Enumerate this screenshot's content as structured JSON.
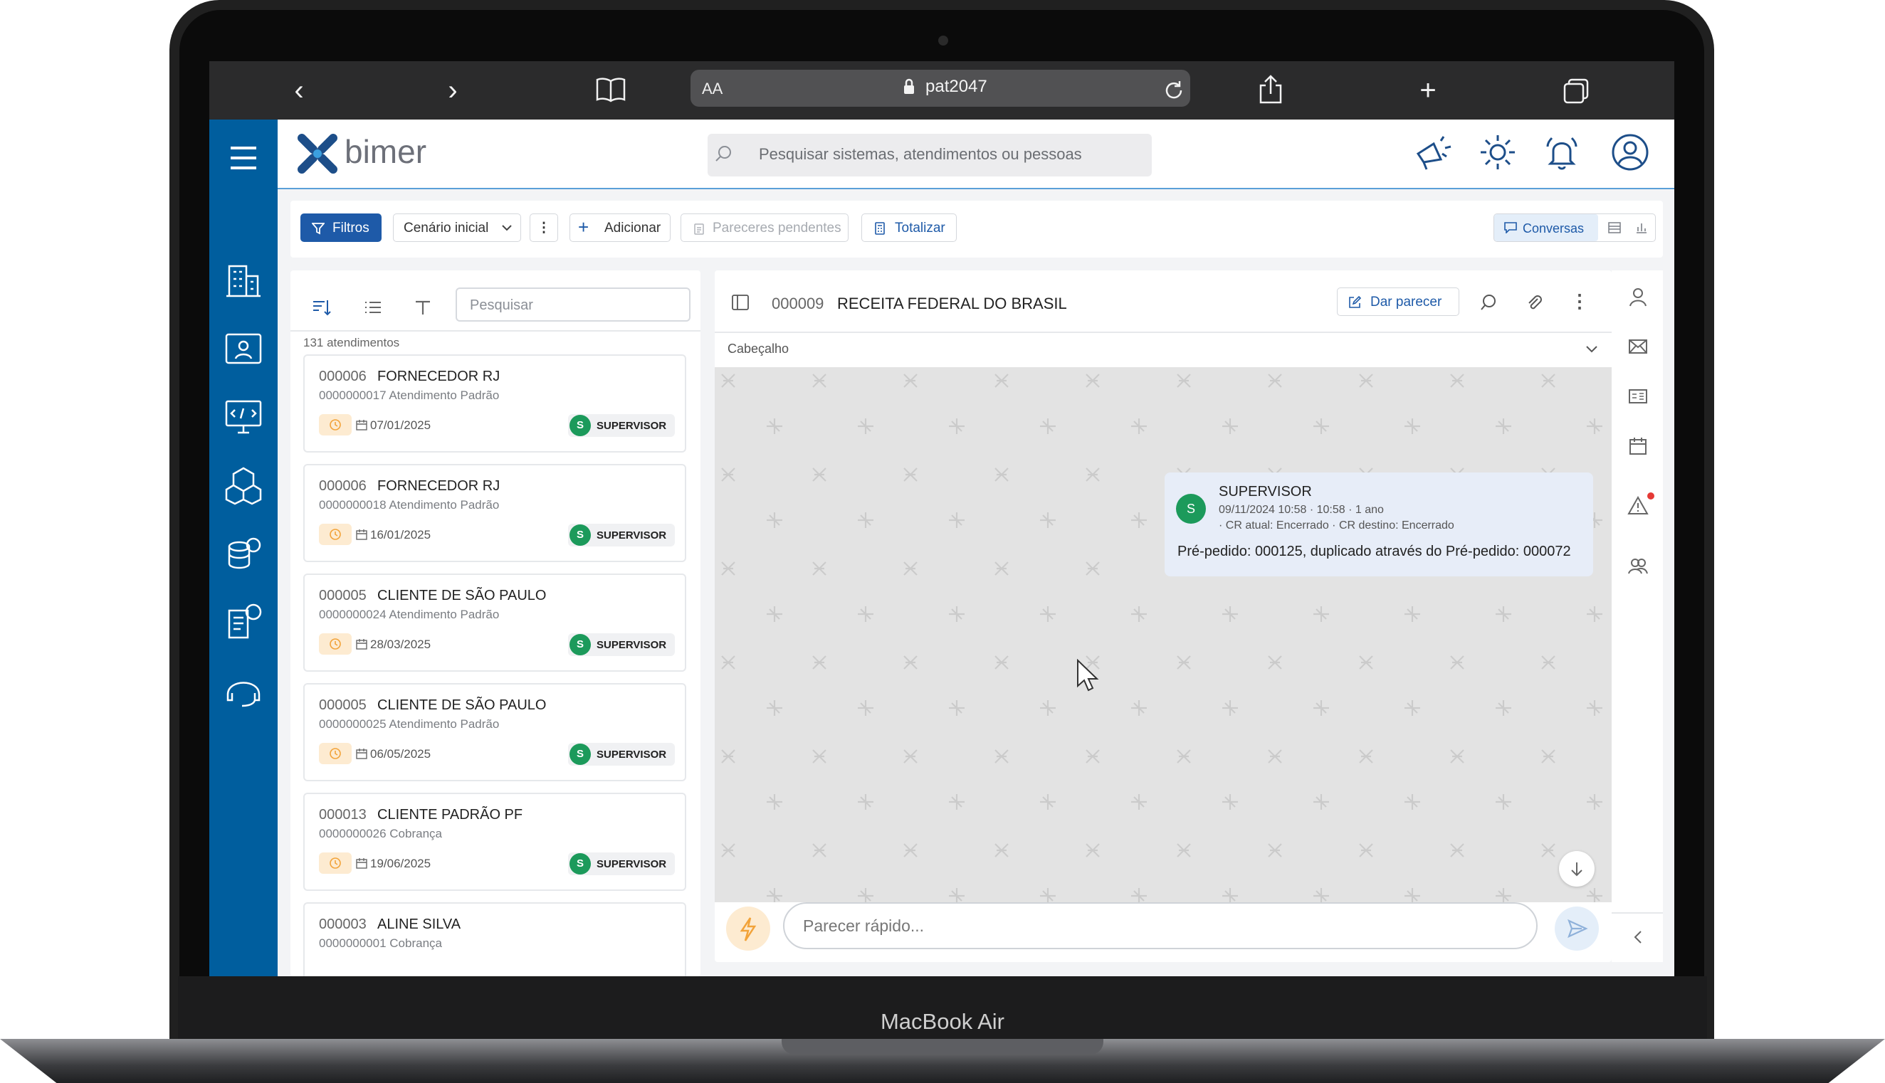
{
  "device": {
    "label": "MacBook Air"
  },
  "browser": {
    "text_size_label": "AA",
    "url": "pat2047"
  },
  "app": {
    "brand": "bimer",
    "search_placeholder": "Pesquisar sistemas, atendimentos ou pessoas"
  },
  "toolbar": {
    "filters_label": "Filtros",
    "scenario_label": "Cenário inicial",
    "add_label": "Adicionar",
    "pending_label": "Pareceres pendentes",
    "totalize_label": "Totalizar",
    "conversations_label": "Conversas"
  },
  "list": {
    "search_placeholder": "Pesquisar",
    "count_label": "131 atendimentos",
    "items": [
      {
        "code": "000006",
        "name": "FORNECEDOR RJ",
        "sub": "0000000017 Atendimento Padrão",
        "date": "07/01/2025",
        "user_initial": "S",
        "user": "SUPERVISOR"
      },
      {
        "code": "000006",
        "name": "FORNECEDOR RJ",
        "sub": "0000000018 Atendimento Padrão",
        "date": "16/01/2025",
        "user_initial": "S",
        "user": "SUPERVISOR"
      },
      {
        "code": "000005",
        "name": "CLIENTE DE SÃO PAULO",
        "sub": "0000000024 Atendimento Padrão",
        "date": "28/03/2025",
        "user_initial": "S",
        "user": "SUPERVISOR"
      },
      {
        "code": "000005",
        "name": "CLIENTE DE SÃO PAULO",
        "sub": "0000000025 Atendimento Padrão",
        "date": "06/05/2025",
        "user_initial": "S",
        "user": "SUPERVISOR"
      },
      {
        "code": "000013",
        "name": "CLIENTE PADRÃO PF",
        "sub": "0000000026 Cobrança",
        "date": "19/06/2025",
        "user_initial": "S",
        "user": "SUPERVISOR"
      },
      {
        "code": "000003",
        "name": "ALINE SILVA",
        "sub": "0000000001 Cobrança",
        "date": "",
        "user_initial": "",
        "user": ""
      }
    ]
  },
  "chat": {
    "code": "000009",
    "title": "RECEITA FEDERAL DO BRASIL",
    "give_opinion_label": "Dar parecer",
    "section_label": "Cabeçalho",
    "message": {
      "avatar_initial": "S",
      "author": "SUPERVISOR",
      "meta": "09/11/2024 10:58 · 10:58 · 1 ano",
      "meta2": "· CR atual: Encerrado · CR destino: Encerrado",
      "text": "Pré-pedido: 000125, duplicado através do Pré-pedido: 000072"
    },
    "composer_placeholder": "Parecer rápido..."
  },
  "colors": {
    "primary": "#005e9e",
    "accent": "#1e5aa8",
    "success": "#1c9a5b",
    "warning": "#f2a33a"
  }
}
